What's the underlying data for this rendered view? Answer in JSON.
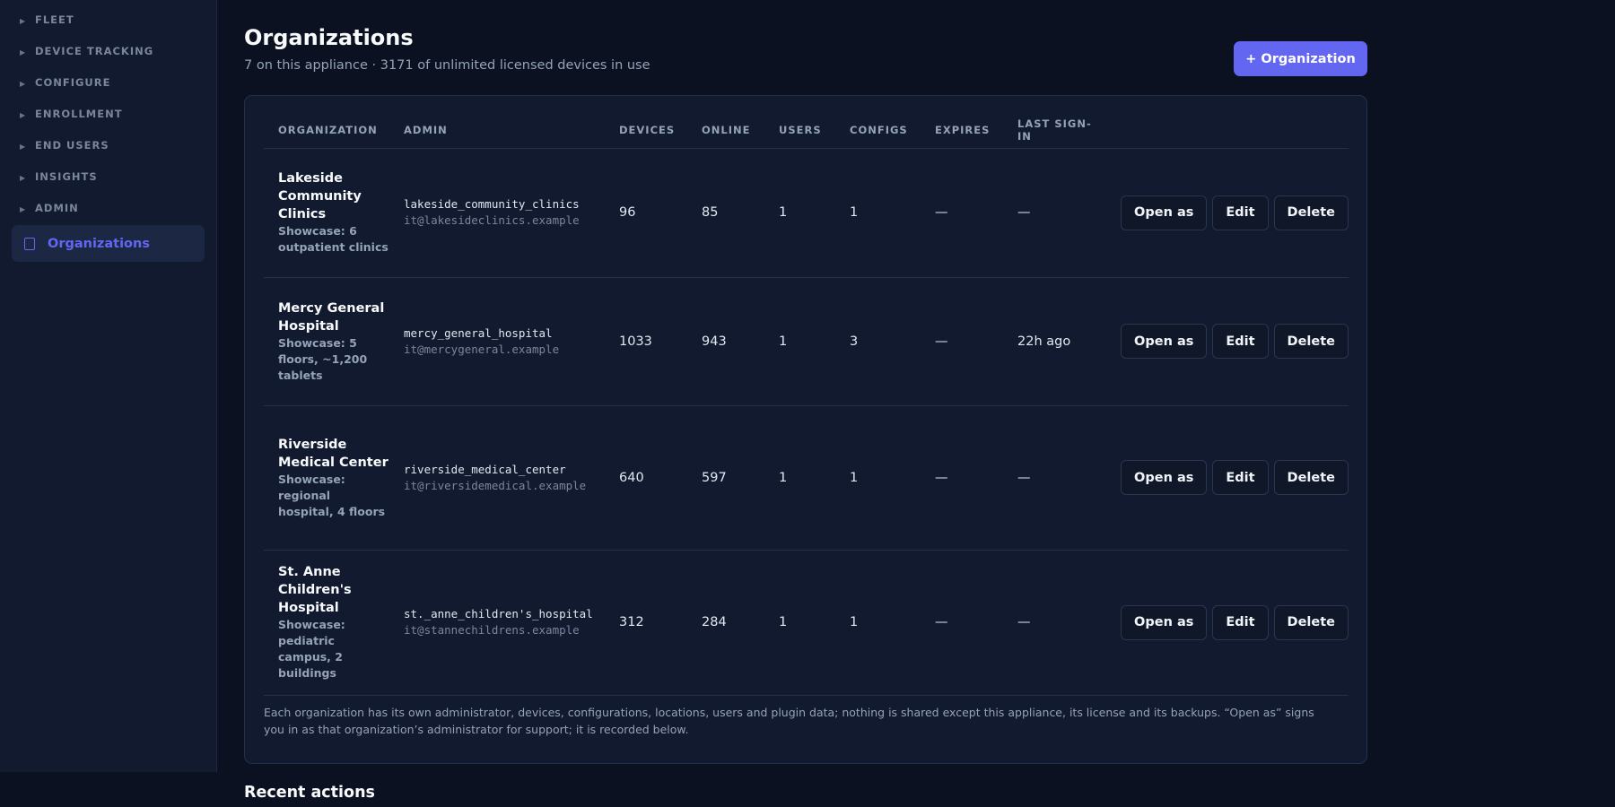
{
  "sidebar": {
    "groups": [
      {
        "label": "FLEET"
      },
      {
        "label": "DEVICE TRACKING"
      },
      {
        "label": "CONFIGURE"
      },
      {
        "label": "ENROLLMENT"
      },
      {
        "label": "END USERS"
      },
      {
        "label": "INSIGHTS"
      },
      {
        "label": "ADMIN"
      }
    ],
    "active": {
      "label": "Organizations",
      "icon": "building-icon"
    }
  },
  "header": {
    "title": "Organizations",
    "subtitle": "7 on this appliance · 3171 of unlimited licensed devices in use",
    "add_button": "+ Organization"
  },
  "table": {
    "columns": [
      "ORGANIZATION",
      "ADMIN",
      "DEVICES",
      "ONLINE",
      "USERS",
      "CONFIGS",
      "EXPIRES",
      "LAST SIGN-IN"
    ],
    "action_labels": {
      "open_as": "Open as",
      "edit": "Edit",
      "delete": "Delete"
    },
    "rows": [
      {
        "name": "Lakeside Community Clinics",
        "description": "Showcase: 6 outpatient clinics",
        "admin_user": "lakeside_community_clinics",
        "admin_email": "it@lakesideclinics.example",
        "devices": "96",
        "online": "85",
        "users": "1",
        "configs": "1",
        "expires": "—",
        "last_sign_in": "—"
      },
      {
        "name": "Mercy General Hospital",
        "description": "Showcase: 5 floors, ~1,200 tablets",
        "admin_user": "mercy_general_hospital",
        "admin_email": "it@mercygeneral.example",
        "devices": "1033",
        "online": "943",
        "users": "1",
        "configs": "3",
        "expires": "—",
        "last_sign_in": "22h ago"
      },
      {
        "name": "Riverside Medical Center",
        "description": "Showcase: regional hospital, 4 floors",
        "admin_user": "riverside_medical_center",
        "admin_email": "it@riversidemedical.example",
        "devices": "640",
        "online": "597",
        "users": "1",
        "configs": "1",
        "expires": "—",
        "last_sign_in": "—"
      },
      {
        "name": "St. Anne Children's Hospital",
        "description": "Showcase: pediatric campus, 2 buildings",
        "admin_user": "st._anne_children's_hospital",
        "admin_email": "it@stannechildrens.example",
        "devices": "312",
        "online": "284",
        "users": "1",
        "configs": "1",
        "expires": "—",
        "last_sign_in": "—"
      }
    ]
  },
  "note": "Each organization has its own administrator, devices, configurations, locations, users and plugin data; nothing is shared except this appliance, its license and its backups. “Open as” signs you in as that organization’s administrator for support; it is recorded below.",
  "recent": {
    "title": "Recent actions"
  },
  "colors": {
    "accent": "#6366f1",
    "background": "#0b1120",
    "panel": "#111a2e"
  }
}
